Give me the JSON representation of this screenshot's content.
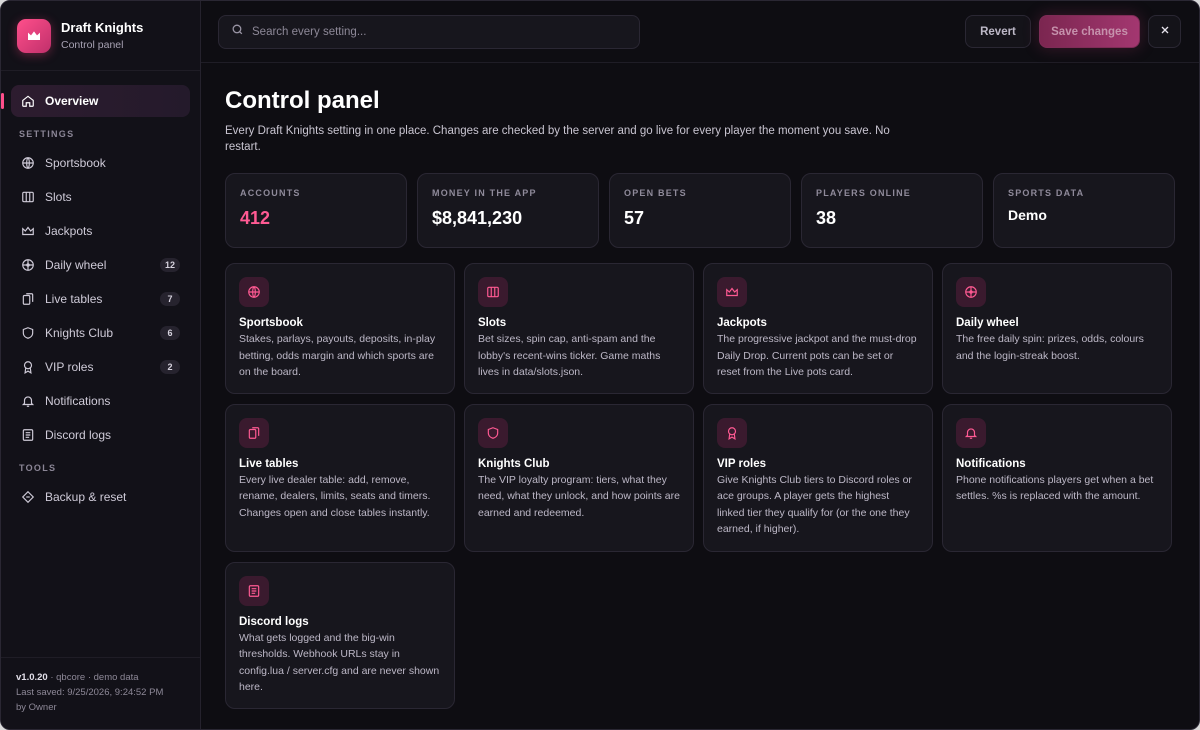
{
  "brand": {
    "name": "Draft Knights",
    "subtitle": "Control panel"
  },
  "nav": {
    "overview": "Overview",
    "settings_label": "SETTINGS",
    "tools_label": "TOOLS",
    "items": [
      {
        "label": "Sportsbook",
        "icon": "globe-icon",
        "badge": ""
      },
      {
        "label": "Slots",
        "icon": "columns-icon",
        "badge": ""
      },
      {
        "label": "Jackpots",
        "icon": "crown-icon",
        "badge": ""
      },
      {
        "label": "Daily wheel",
        "icon": "wheel-icon",
        "badge": "12"
      },
      {
        "label": "Live tables",
        "icon": "cards-icon",
        "badge": "7"
      },
      {
        "label": "Knights Club",
        "icon": "shield-icon",
        "badge": "6"
      },
      {
        "label": "VIP roles",
        "icon": "award-icon",
        "badge": "2"
      },
      {
        "label": "Notifications",
        "icon": "bell-icon",
        "badge": ""
      },
      {
        "label": "Discord logs",
        "icon": "document-icon",
        "badge": ""
      }
    ],
    "backup": "Backup & reset"
  },
  "footer": {
    "version": "v1.0.20",
    "env": " · qbcore · demo data",
    "saved": "Last saved: 9/25/2026, 9:24:52 PM",
    "by": "by Owner"
  },
  "topbar": {
    "search_placeholder": "Search every setting...",
    "revert": "Revert",
    "save": "Save changes"
  },
  "page": {
    "title": "Control panel",
    "description": "Every Draft Knights setting in one place. Changes are checked by the server and go live for every player the moment you save. No restart."
  },
  "stats": [
    {
      "label": "ACCOUNTS",
      "value": "412"
    },
    {
      "label": "MONEY IN THE APP",
      "value": "$8,841,230"
    },
    {
      "label": "OPEN BETS",
      "value": "57"
    },
    {
      "label": "PLAYERS ONLINE",
      "value": "38"
    },
    {
      "label": "SPORTS DATA",
      "value": "Demo"
    }
  ],
  "cards": [
    {
      "title": "Sportsbook",
      "desc": "Stakes, parlays, payouts, deposits, in-play betting, odds margin and which sports are on the board."
    },
    {
      "title": "Slots",
      "desc": "Bet sizes, spin cap, anti-spam and the lobby's recent-wins ticker. Game maths lives in data/slots.json."
    },
    {
      "title": "Jackpots",
      "desc": "The progressive jackpot and the must-drop Daily Drop. Current pots can be set or reset from the Live pots card."
    },
    {
      "title": "Daily wheel",
      "desc": "The free daily spin: prizes, odds, colours and the login-streak boost."
    },
    {
      "title": "Live tables",
      "desc": "Every live dealer table: add, remove, rename, dealers, limits, seats and timers. Changes open and close tables instantly."
    },
    {
      "title": "Knights Club",
      "desc": "The VIP loyalty program: tiers, what they need, what they unlock, and how points are earned and redeemed."
    },
    {
      "title": "VIP roles",
      "desc": "Give Knights Club tiers to Discord roles or ace groups. A player gets the highest linked tier they qualify for (or the one they earned, if higher)."
    },
    {
      "title": "Notifications",
      "desc": "Phone notifications players get when a bet settles. %s is replaced with the amount."
    },
    {
      "title": "Discord logs",
      "desc": "What gets logged and the big-win thresholds. Webhook URLs stay in config.lua / server.cfg and are never shown here."
    }
  ],
  "colors": {
    "accent": "#ff4f8b",
    "background": "#0e0d12",
    "card": "#17161d"
  }
}
